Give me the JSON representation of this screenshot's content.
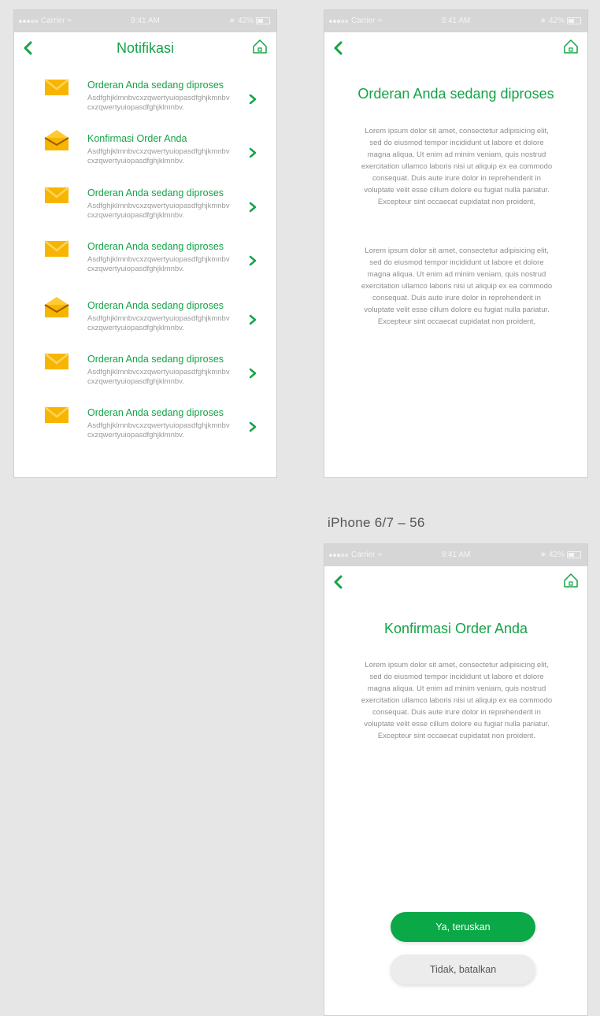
{
  "colors": {
    "accent": "#15a347",
    "button_green": "#0aa847",
    "envelope": "#f7b500",
    "background": "#e6e6e6"
  },
  "statusbar": {
    "carrier": "Carrier",
    "time": "9:41 AM",
    "battery": "42%"
  },
  "screen1": {
    "title": "Notifikasi",
    "items": [
      {
        "title": "Orderan Anda sedang diproses",
        "subtitle": "Asdfghjklmnbvcxzqwertyuiopasdfghjkmnbvcxzqwertyuiopasdfghjklmnbv.",
        "icon": "closed-envelope-icon"
      },
      {
        "title": "Konfirmasi Order Anda",
        "subtitle": "Asdfghjklmnbvcxzqwertyuiopasdfghjkmnbvcxzqwertyuiopasdfghjklmnbv.",
        "icon": "open-envelope-icon"
      },
      {
        "title": "Orderan Anda sedang diproses",
        "subtitle": "Asdfghjklmnbvcxzqwertyuiopasdfghjkmnbvcxzqwertyuiopasdfghjklmnbv.",
        "icon": "closed-envelope-icon"
      },
      {
        "title": "Orderan Anda sedang diproses",
        "subtitle": "Asdfghjklmnbvcxzqwertyuiopasdfghjkmnbvcxzqwertyuiopasdfghjklmnbv.",
        "icon": "closed-envelope-icon"
      },
      {
        "title": "Orderan Anda sedang diproses",
        "subtitle": "Asdfghjklmnbvcxzqwertyuiopasdfghjkmnbvcxzqwertyuiopasdfghjklmnbv.",
        "icon": "open-envelope-icon"
      },
      {
        "title": "Orderan Anda sedang diproses",
        "subtitle": "Asdfghjklmnbvcxzqwertyuiopasdfghjkmnbvcxzqwertyuiopasdfghjklmnbv.",
        "icon": "closed-envelope-icon"
      },
      {
        "title": "Orderan Anda sedang diproses",
        "subtitle": "Asdfghjklmnbvcxzqwertyuiopasdfghjkmnbvcxzqwertyuiopasdfghjklmnbv.",
        "icon": "closed-envelope-icon"
      }
    ]
  },
  "screen2": {
    "title": "Orderan Anda sedang diproses",
    "paragraph1": "Lorem ipsum dolor sit amet, consectetur adipisicing elit, sed do eiusmod tempor incididunt ut labore et dolore magna aliqua. Ut enim ad minim veniam, quis nostrud exercitation ullamco laboris nisi ut aliquip ex ea commodo consequat. Duis aute irure dolor in reprehenderit in voluptate velit esse cillum dolore eu fugiat nulla pariatur. Excepteur sint occaecat cupidatat non proident,",
    "paragraph2": "Lorem ipsum dolor sit amet, consectetur adipisicing elit, sed do eiusmod tempor incididunt ut labore et dolore magna aliqua. Ut enim ad minim veniam, quis nostrud exercitation ullamco laboris nisi ut aliquip ex ea commodo consequat. Duis aute irure dolor in reprehenderit in voluptate velit esse cillum dolore eu fugiat nulla pariatur. Excepteur sint occaecat cupidatat non proident,"
  },
  "screen3": {
    "frame_label": "iPhone 6/7 – 56",
    "title": "Konfirmasi Order Anda",
    "paragraph": "Lorem ipsum dolor sit amet, consectetur adipisicing elit, sed do eiusmod tempor incididunt ut labore et dolore magna aliqua. Ut enim ad minim veniam, quis nostrud exercitation ullamco laboris nisi ut aliquip ex ea commodo consequat. Duis aute irure dolor in reprehenderit in voluptate velit esse cillum dolore eu fugiat nulla pariatur. Excepteur sint occaecat cupidatat non proident.",
    "confirm_label": "Ya, teruskan",
    "cancel_label": "Tidak, batalkan"
  }
}
